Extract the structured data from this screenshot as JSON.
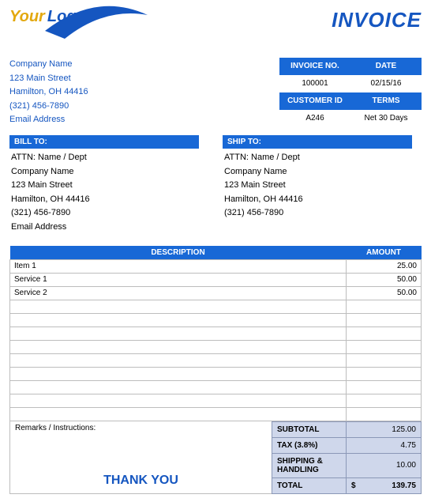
{
  "logo": {
    "your": "Your",
    "logo": "Logo"
  },
  "title": "INVOICE",
  "company": {
    "name": "Company Name",
    "street": "123 Main Street",
    "citystate": "Hamilton, OH  44416",
    "phone": "(321) 456-7890",
    "email": "Email Address"
  },
  "meta": {
    "heads": {
      "invoice_no": "INVOICE NO.",
      "date": "DATE",
      "customer_id": "CUSTOMER ID",
      "terms": "TERMS"
    },
    "invoice_no": "100001",
    "date": "02/15/16",
    "customer_id": "A246",
    "terms": "Net 30 Days"
  },
  "billto": {
    "head": "BILL TO:",
    "attn": "ATTN: Name / Dept",
    "company": "Company Name",
    "street": "123 Main Street",
    "citystate": "Hamilton, OH  44416",
    "phone": "(321) 456-7890",
    "email": "Email Address"
  },
  "shipto": {
    "head": "SHIP TO:",
    "attn": "ATTN: Name / Dept",
    "company": "Company Name",
    "street": "123 Main Street",
    "citystate": "Hamilton, OH  44416",
    "phone": "(321) 456-7890"
  },
  "lines": {
    "heads": {
      "description": "DESCRIPTION",
      "amount": "AMOUNT"
    },
    "rows": [
      {
        "d": "Item 1",
        "a": "25.00"
      },
      {
        "d": "Service 1",
        "a": "50.00"
      },
      {
        "d": "Service 2",
        "a": "50.00"
      },
      {
        "d": "",
        "a": ""
      },
      {
        "d": "",
        "a": ""
      },
      {
        "d": "",
        "a": ""
      },
      {
        "d": "",
        "a": ""
      },
      {
        "d": "",
        "a": ""
      },
      {
        "d": "",
        "a": ""
      },
      {
        "d": "",
        "a": ""
      },
      {
        "d": "",
        "a": ""
      },
      {
        "d": "",
        "a": ""
      }
    ]
  },
  "remarks_label": "Remarks / Instructions:",
  "thankyou": "THANK YOU",
  "totals": {
    "subtotal_lbl": "SUBTOTAL",
    "subtotal": "125.00",
    "tax_lbl": "TAX (3.8%)",
    "tax": "4.75",
    "ship_lbl": "SHIPPING & HANDLING",
    "ship": "10.00",
    "total_lbl": "TOTAL",
    "total_cur": "$",
    "total": "139.75"
  }
}
